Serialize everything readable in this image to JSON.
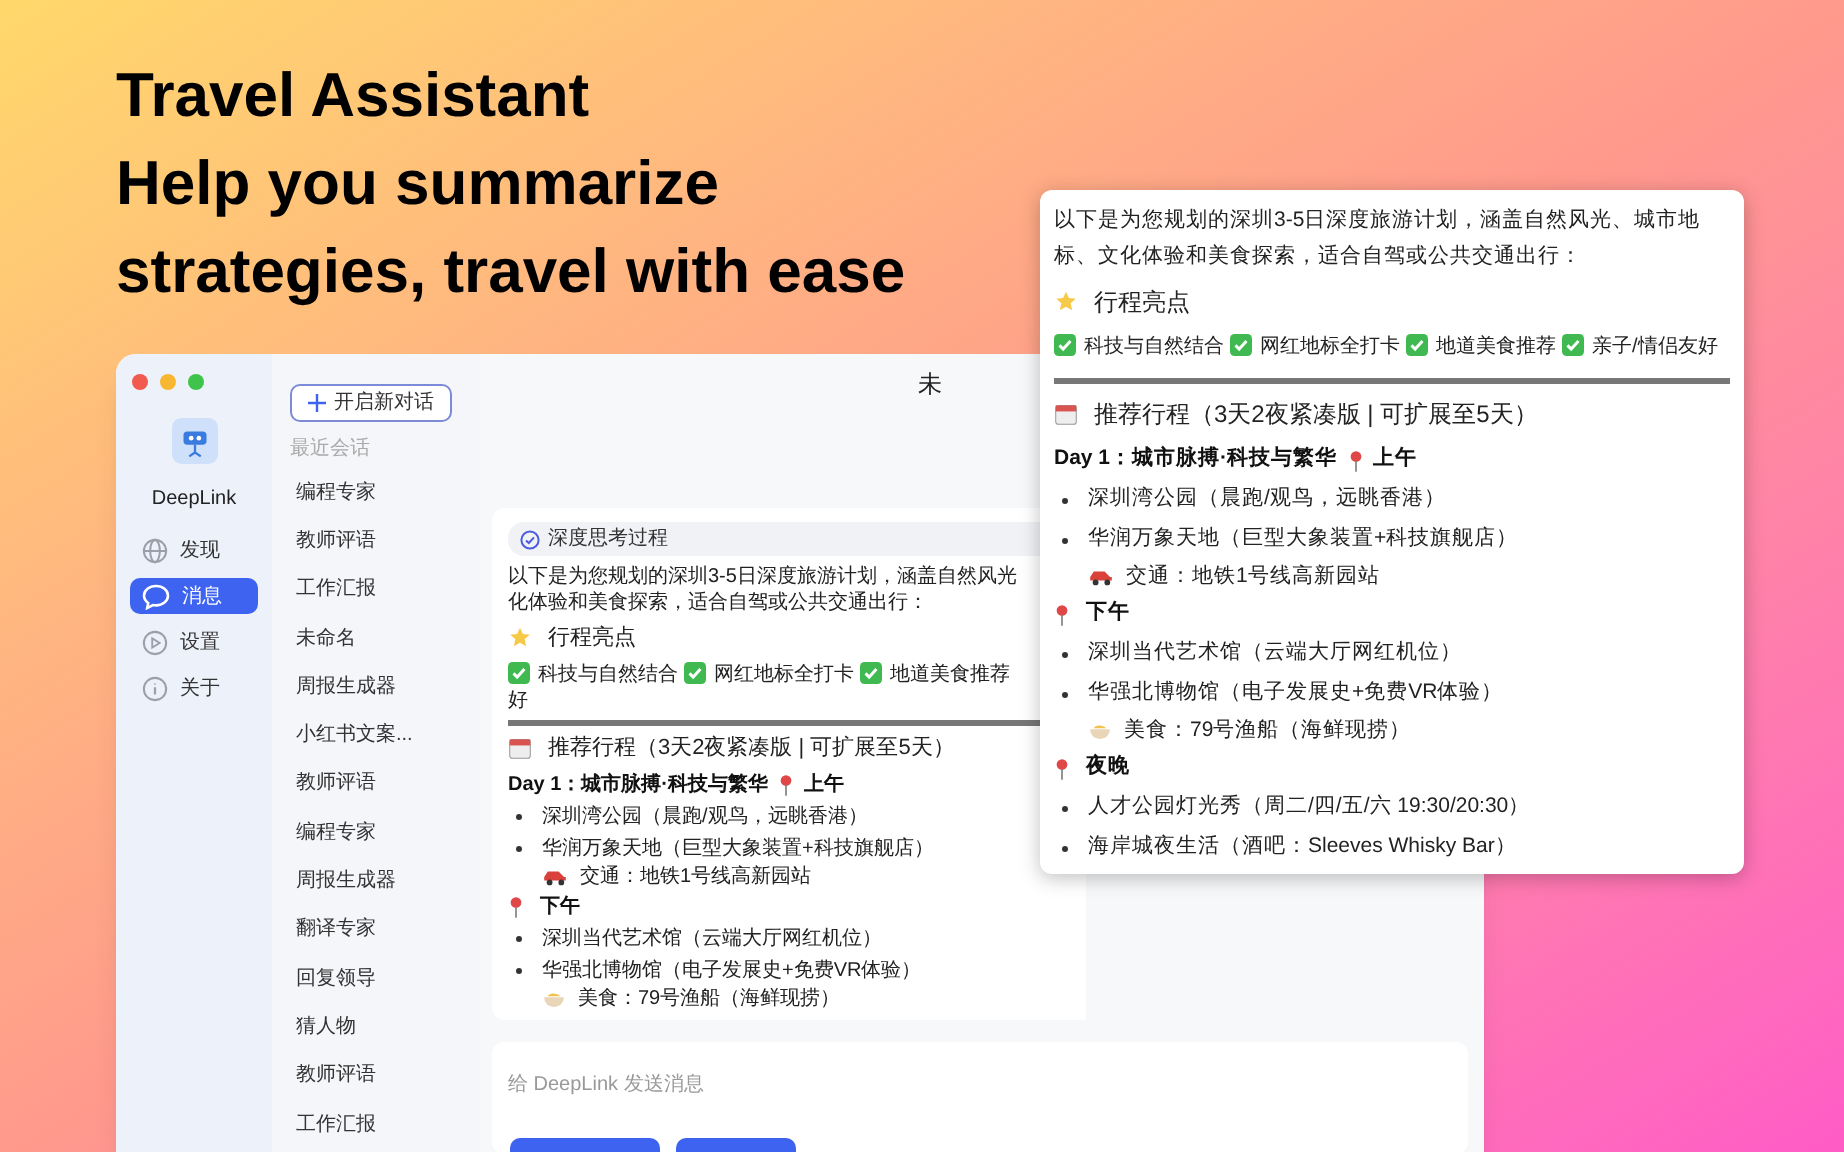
{
  "headline": [
    "Travel Assistant",
    "Help you summarize",
    "strategies, travel with ease"
  ],
  "app": {
    "name": "DeepLink",
    "nav": [
      {
        "label": "发现",
        "selected": false
      },
      {
        "label": "消息",
        "selected": true
      },
      {
        "label": "设置",
        "selected": false
      },
      {
        "label": "关于",
        "selected": false
      }
    ],
    "new_chat": "开启新对话",
    "recent_label": "最近会话",
    "conversations": [
      "编程专家",
      "教师评语",
      "工作汇报",
      "未命名",
      "周报生成器",
      "小红书文案...",
      "教师评语",
      "编程专家",
      "周报生成器",
      "翻译专家",
      "回复领导",
      "猜人物",
      "教师评语",
      "工作汇报"
    ],
    "title": "未",
    "message": {
      "thinking": "深度思考过程",
      "intro": [
        "以下是为您规划的深圳3-5日深度旅游计划，涵盖自然风光",
        "化体验和美食探索，适合自驾或公共交通出行："
      ],
      "highlights_title": "行程亮点",
      "highlights": [
        "科技与自然结合",
        "网红地标全打卡",
        "地道美食推荐"
      ],
      "highlights_wrap": "好",
      "plan_title": "推荐行程（3天2夜紧凑版 | 可扩展至5天）",
      "day": "Day 1：城市脉搏·科技与繁华",
      "day_slot": "上午",
      "blocks": [
        {
          "kind": "bullet",
          "text": "深圳湾公园（晨跑/观鸟，远眺香港）"
        },
        {
          "kind": "bullet",
          "text": "华润万象天地（巨型大象装置+科技旗舰店）"
        },
        {
          "kind": "transport",
          "text": "交通：地铁1号线高新园站"
        },
        {
          "kind": "slot",
          "text": "下午"
        },
        {
          "kind": "bullet",
          "text": "深圳当代艺术馆（云端大厅网红机位）"
        },
        {
          "kind": "bullet",
          "text": "华强北博物馆（电子发展史+免费VR体验）"
        },
        {
          "kind": "food",
          "text": "美食：79号渔船（海鲜现捞）"
        }
      ]
    },
    "input_placeholder": "给 DeepLink 发送消息"
  },
  "popup": {
    "intro": "以下是为您规划的深圳3-5日深度旅游计划，涵盖自然风光、城市地标、文化体验和美食探索，适合自驾或公共交通出行：",
    "highlights_title": "行程亮点",
    "highlights": [
      "科技与自然结合",
      "网红地标全打卡",
      "地道美食推荐",
      "亲子/情侣友好"
    ],
    "plan_title": "推荐行程（3天2夜紧凑版 | 可扩展至5天）",
    "day": "Day 1：城市脉搏·科技与繁华",
    "day_slot": "上午",
    "blocks": [
      {
        "kind": "bullet",
        "text": "深圳湾公园（晨跑/观鸟，远眺香港）"
      },
      {
        "kind": "bullet",
        "text": "华润万象天地（巨型大象装置+科技旗舰店）"
      },
      {
        "kind": "transport",
        "text": "交通：地铁1号线高新园站"
      },
      {
        "kind": "slot",
        "text": "下午"
      },
      {
        "kind": "bullet",
        "text": "深圳当代艺术馆（云端大厅网红机位）"
      },
      {
        "kind": "bullet",
        "text": "华强北博物馆（电子发展史+免费VR体验）"
      },
      {
        "kind": "food",
        "text": "美食：79号渔船（海鲜现捞）"
      },
      {
        "kind": "slot",
        "text": "夜晚"
      },
      {
        "kind": "bullet",
        "text": "人才公园灯光秀（周二/四/五/六 19:30/20:30）"
      },
      {
        "kind": "bullet",
        "text": "海岸城夜生活（酒吧：Sleeves Whisky Bar）"
      }
    ]
  }
}
